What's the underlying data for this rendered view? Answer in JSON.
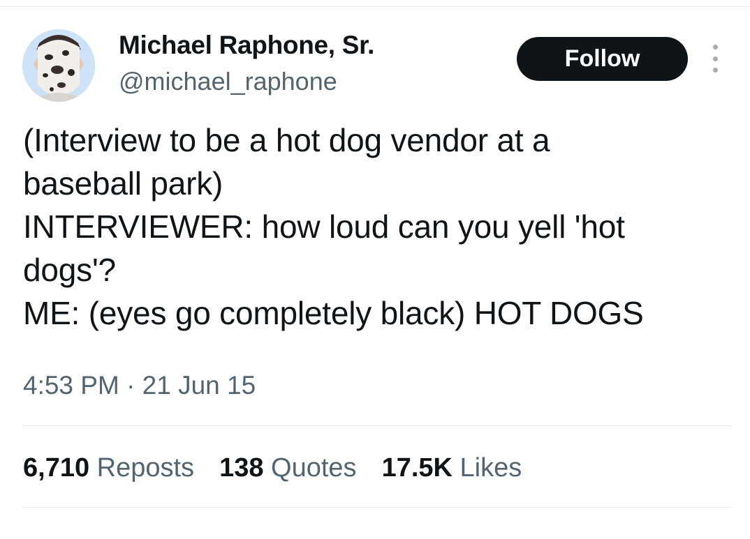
{
  "author": {
    "name": "Michael Raphone, Sr.",
    "handle": "@michael_raphone"
  },
  "follow_label": "Follow",
  "tweet": {
    "lines": [
      "(Interview to be a hot dog vendor at a",
      "baseball park)",
      "INTERVIEWER: how loud can you yell 'hot",
      "dogs'?",
      "ME: (eyes go completely black) HOT DOGS"
    ],
    "timestamp": "4:53 PM · 21 Jun 15"
  },
  "stats": {
    "reposts": {
      "count": "6,710",
      "label": "Reposts"
    },
    "quotes": {
      "count": "138",
      "label": "Quotes"
    },
    "likes": {
      "count": "17.5K",
      "label": "Likes"
    }
  },
  "icons": {
    "more": "more-options-icon"
  },
  "colors": {
    "text": "#0f1419",
    "secondary": "#536471",
    "button_bg": "#0f1419",
    "divider": "#e6e9eb"
  }
}
